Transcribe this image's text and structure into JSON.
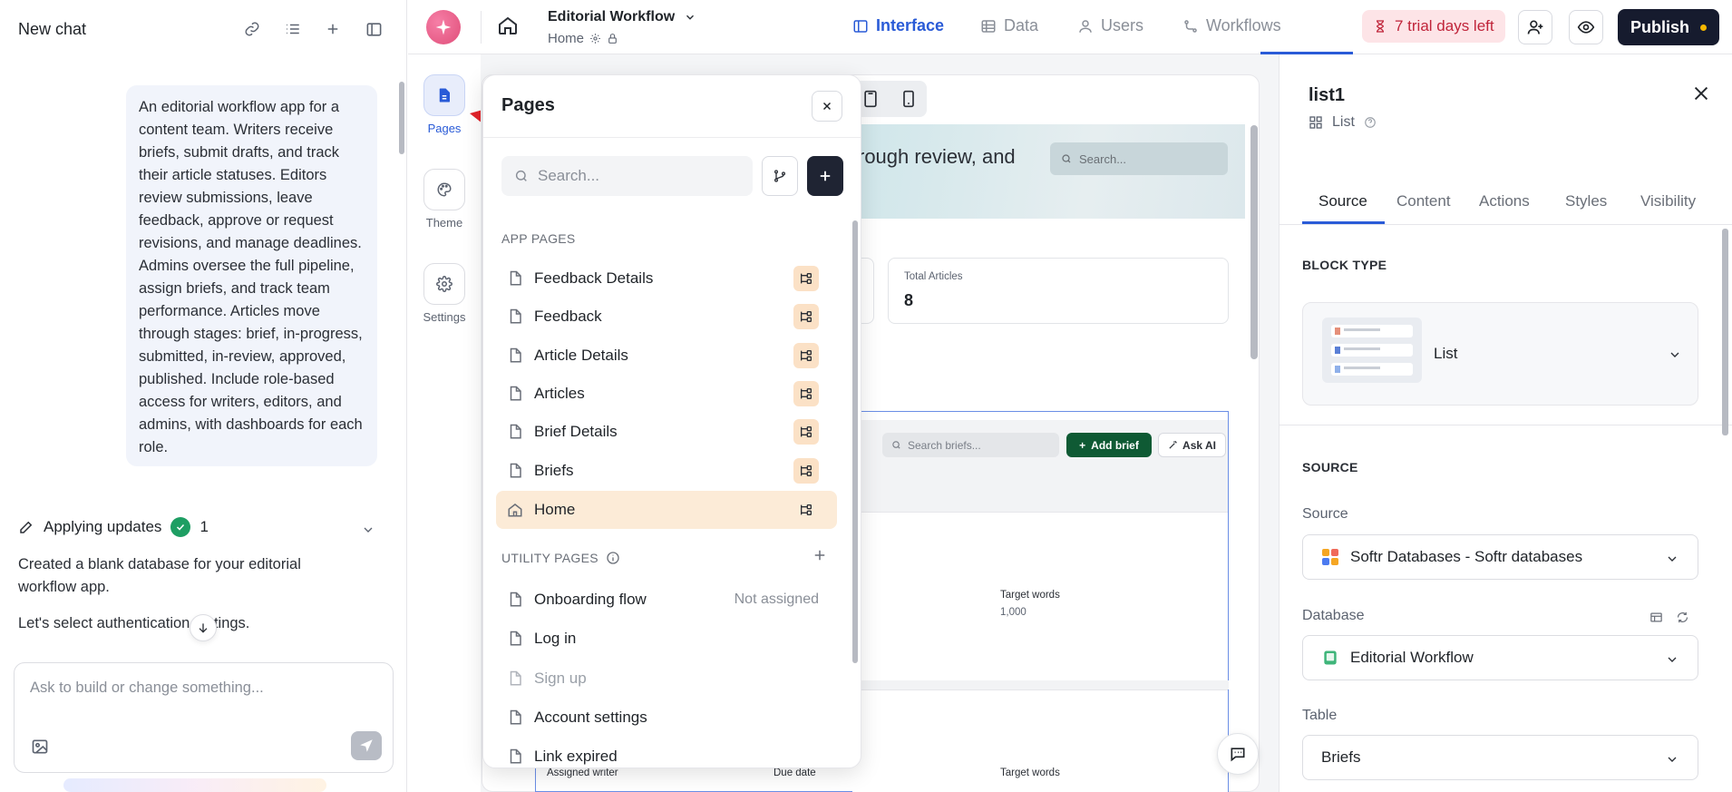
{
  "chat": {
    "title": "New chat",
    "prompt": "An editorial workflow app for a content team. Writers receive briefs, submit drafts, and track their article statuses. Editors review submissions, leave feedback, approve or request revisions, and manage deadlines. Admins oversee the full pipeline, assign briefs, and track team performance. Articles move through stages: brief, in-progress, submitted, in-review, approved, published. Include role-based access for writers, editors, and admins, with dashboards for each role.",
    "applying_label": "Applying updates",
    "applying_count": "1",
    "message1": "Created a blank database for your editorial workflow app.",
    "message2": "Let's select authentication settings.",
    "input_placeholder": "Ask to build or change something..."
  },
  "topbar": {
    "app_title": "Editorial Workflow",
    "page_name": "Home",
    "tabs": [
      {
        "label": "Interface"
      },
      {
        "label": "Data"
      },
      {
        "label": "Users"
      },
      {
        "label": "Workflows"
      }
    ],
    "trial": "7 trial days left",
    "publish": "Publish"
  },
  "rail": {
    "items": [
      {
        "label": "Pages"
      },
      {
        "label": "Theme"
      },
      {
        "label": "Settings"
      }
    ]
  },
  "pages_panel": {
    "title": "Pages",
    "search_placeholder": "Search...",
    "app_pages_label": "APP PAGES",
    "app_pages": [
      {
        "name": "Feedback Details"
      },
      {
        "name": "Feedback"
      },
      {
        "name": "Article Details"
      },
      {
        "name": "Articles"
      },
      {
        "name": "Brief Details"
      },
      {
        "name": "Briefs"
      },
      {
        "name": "Home"
      }
    ],
    "utility_label": "UTILITY PAGES",
    "utility_pages": [
      {
        "name": "Onboarding flow",
        "status": "Not assigned"
      },
      {
        "name": "Log in"
      },
      {
        "name": "Sign up"
      },
      {
        "name": "Account settings"
      },
      {
        "name": "Link expired"
      }
    ]
  },
  "preview": {
    "hero_text": "rough review, and",
    "hero_search": "Search...",
    "stat_label": "Total Articles",
    "stat_value": "8",
    "search_briefs": "Search briefs...",
    "add_brief": "Add brief",
    "ask_ai": "Ask AI",
    "target_label": "Target words",
    "target_value": "1,000",
    "row2_labels": [
      "Assigned writer",
      "Due date",
      "Target words"
    ]
  },
  "inspector": {
    "title": "list1",
    "type": "List",
    "tabs": [
      "Source",
      "Content",
      "Actions",
      "Styles",
      "Visibility"
    ],
    "block_type_label": "BLOCK TYPE",
    "block_type": "List",
    "source_section": "SOURCE",
    "source_label": "Source",
    "source_value": "Softr Databases - Softr databases",
    "database_label": "Database",
    "database_value": "Editorial Workflow",
    "table_label": "Table",
    "table_value": "Briefs"
  },
  "colors": {
    "accent": "#2a5bd7",
    "publish_bg": "#161b2e",
    "trial_bg": "#fde4e7",
    "add_brief_bg": "#0f5a34",
    "active_page_bg": "#fcebd7"
  }
}
